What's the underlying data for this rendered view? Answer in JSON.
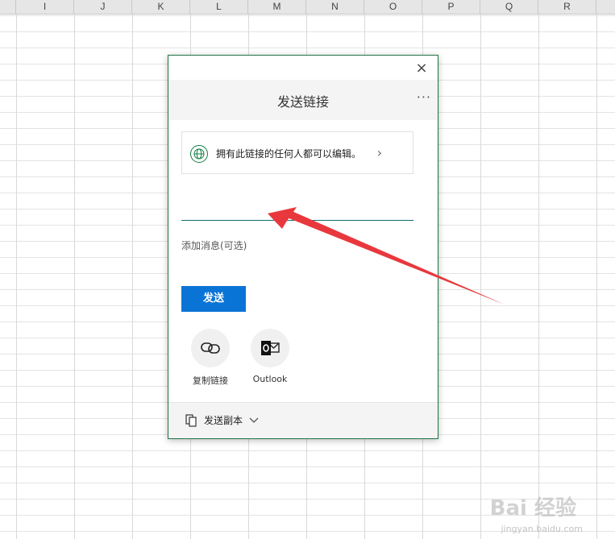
{
  "sheet": {
    "columns": [
      "I",
      "J",
      "K",
      "L",
      "M",
      "N",
      "O",
      "P",
      "Q",
      "R"
    ]
  },
  "dialog": {
    "close_symbol": "×",
    "title": "发送链接",
    "more_symbol": "···",
    "permission_text": "拥有此链接的任何人都可以编辑。",
    "permission_chevron": "›",
    "name_input_value": "",
    "message_placeholder": "添加消息(可选)",
    "send_label": "发送",
    "options": [
      {
        "label": "复制链接",
        "icon": "link-icon"
      },
      {
        "label": "Outlook",
        "icon": "outlook-icon"
      }
    ],
    "footer_label": "发送副本"
  },
  "annotation": {
    "arrow_color": "#e8383d"
  },
  "colors": {
    "accent": "#217346",
    "send_button": "#0a74d6",
    "input_underline": "#0f6e6e"
  },
  "watermark": {
    "main": "Bai 经验",
    "sub": "jingyan.baidu.com"
  }
}
